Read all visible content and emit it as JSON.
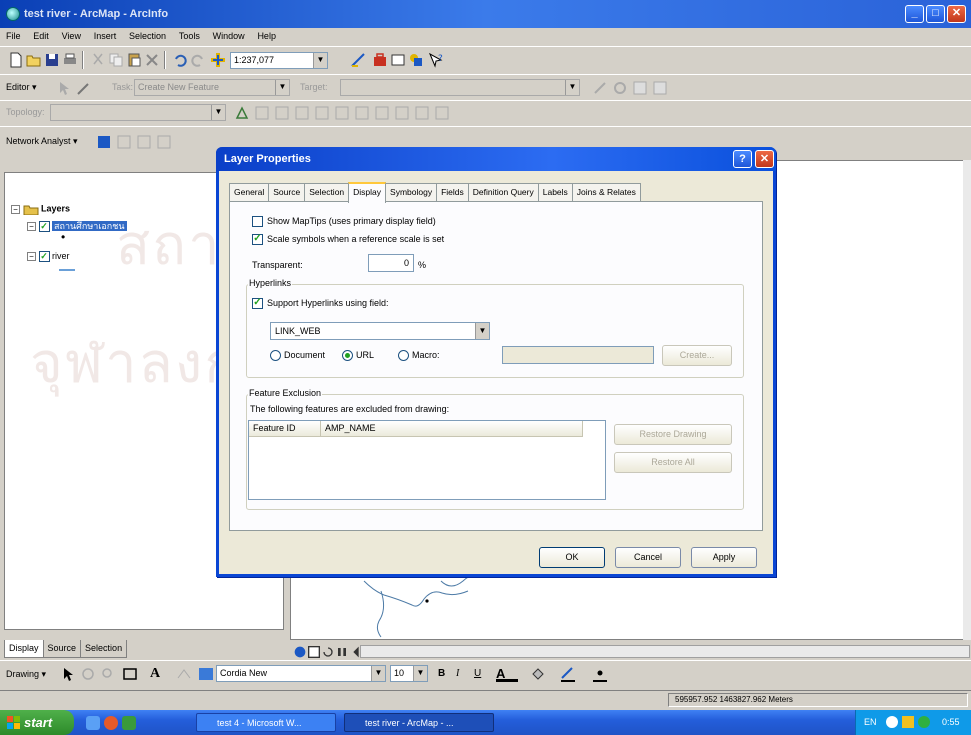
{
  "window": {
    "title": "test river - ArcMap - ArcInfo",
    "minimize": "_",
    "maximize": "□",
    "close": "✕"
  },
  "menu": [
    "File",
    "Edit",
    "View",
    "Insert",
    "Selection",
    "Tools",
    "Window",
    "Help"
  ],
  "toolbar_standard": {
    "scale": "1:237,077"
  },
  "toolbar_editor": {
    "editor_label": "Editor ▾",
    "task_label": "Task:",
    "task_value": "Create New Feature",
    "target_label": "Target:",
    "target_value": ""
  },
  "toolbar_topology": {
    "label": "Topology:",
    "value": ""
  },
  "toolbar_network": {
    "label": "Network Analyst ▾"
  },
  "toc": {
    "root_label": "Layers",
    "layers": [
      {
        "label": "สถานศึกษาเอกชน",
        "checked": true,
        "selected": true
      },
      {
        "label": "river",
        "checked": true,
        "selected": false
      }
    ],
    "tabs": [
      "Display",
      "Source",
      "Selection"
    ]
  },
  "dialog": {
    "title": "Layer Properties",
    "help": "?",
    "close": "✕",
    "tabs": [
      "General",
      "Source",
      "Selection",
      "Display",
      "Symbology",
      "Fields",
      "Definition Query",
      "Labels",
      "Joins & Relates"
    ],
    "active_tab": "Display",
    "show_maptips": {
      "label": "Show MapTips (uses primary display field)",
      "checked": false
    },
    "scale_symbols": {
      "label": "Scale symbols when a reference scale is set",
      "checked": true
    },
    "transparent": {
      "label": "Transparent:",
      "value": "0",
      "unit": "%"
    },
    "hyperlinks": {
      "group_label": "Hyperlinks",
      "support": {
        "label": "Support Hyperlinks using field:",
        "checked": true
      },
      "field_value": "LINK_WEB",
      "options": [
        "Document",
        "URL",
        "Macro:"
      ],
      "selected_option": "URL",
      "macro_value": "",
      "create_button": "Create..."
    },
    "feature_exclusion": {
      "group_label": "Feature Exclusion",
      "description": "The following features are excluded from drawing:",
      "columns": [
        "Feature ID",
        "AMP_NAME"
      ],
      "restore_drawing_button": "Restore Drawing",
      "restore_all_button": "Restore All"
    },
    "buttons": {
      "ok": "OK",
      "cancel": "Cancel",
      "apply": "Apply"
    }
  },
  "drawing_toolbar": {
    "drawing_label": "Drawing ▾",
    "font": "Cordia New",
    "size": "10",
    "bold": "B",
    "italic": "I",
    "underline": "U"
  },
  "status": {
    "coordinates": "595957.952  1463827.962 Meters"
  },
  "taskbar": {
    "start": "start",
    "tasks": [
      {
        "label": "test 4 - Microsoft W...",
        "active": false
      },
      {
        "label": "test river - ArcMap - ...",
        "active": true
      }
    ],
    "lang": "EN",
    "time": "0:55"
  },
  "watermark": {
    "line1": "สถาบันวิทยบริการ",
    "line2": "จุฬาลงกรณ์มหาวิทยาลัย"
  },
  "colors": {
    "titlebar": "#0a46d4",
    "taskbar": "#245edb",
    "start": "#3c9a37",
    "checkmark": "#21a121"
  }
}
